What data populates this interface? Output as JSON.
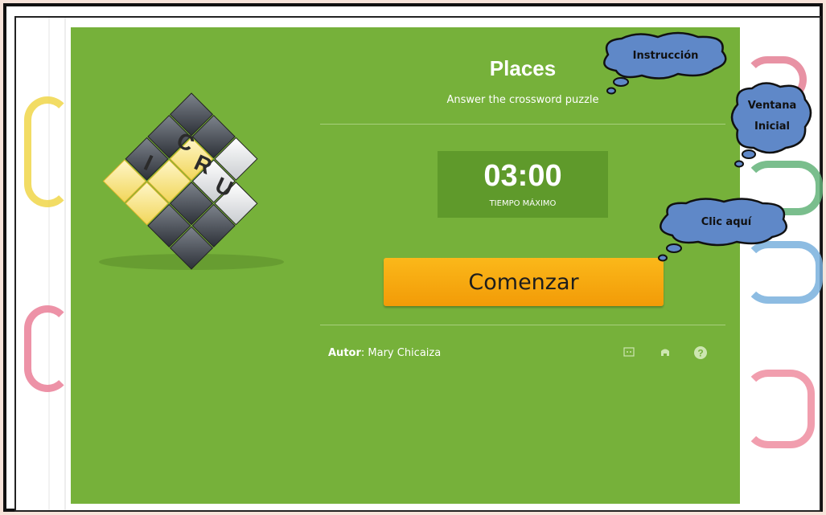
{
  "game": {
    "title": "Places",
    "subtitle": "Answer the crossword puzzle",
    "timer": {
      "value": "03:00",
      "label": "TIEMPO MÁXIMO"
    },
    "start_button": "Comenzar",
    "author": {
      "label": "Autor",
      "name": ": Mary Chicaiza"
    },
    "logo_letters": [
      "C",
      "R",
      "U",
      "I"
    ],
    "toolbar_icons": [
      "fullscreen-icon",
      "embed-icon",
      "help-icon"
    ]
  },
  "annotations": {
    "instruction": "Instrucción",
    "ventana_line1": "Ventana",
    "ventana_line2": "Inicial",
    "clic": "Clic aquí"
  },
  "colors": {
    "panel_green": "#76b13a",
    "timer_green": "#5f9a2b",
    "button_orange": "#f5a90f",
    "bubble_blue": "#5f88c8"
  }
}
